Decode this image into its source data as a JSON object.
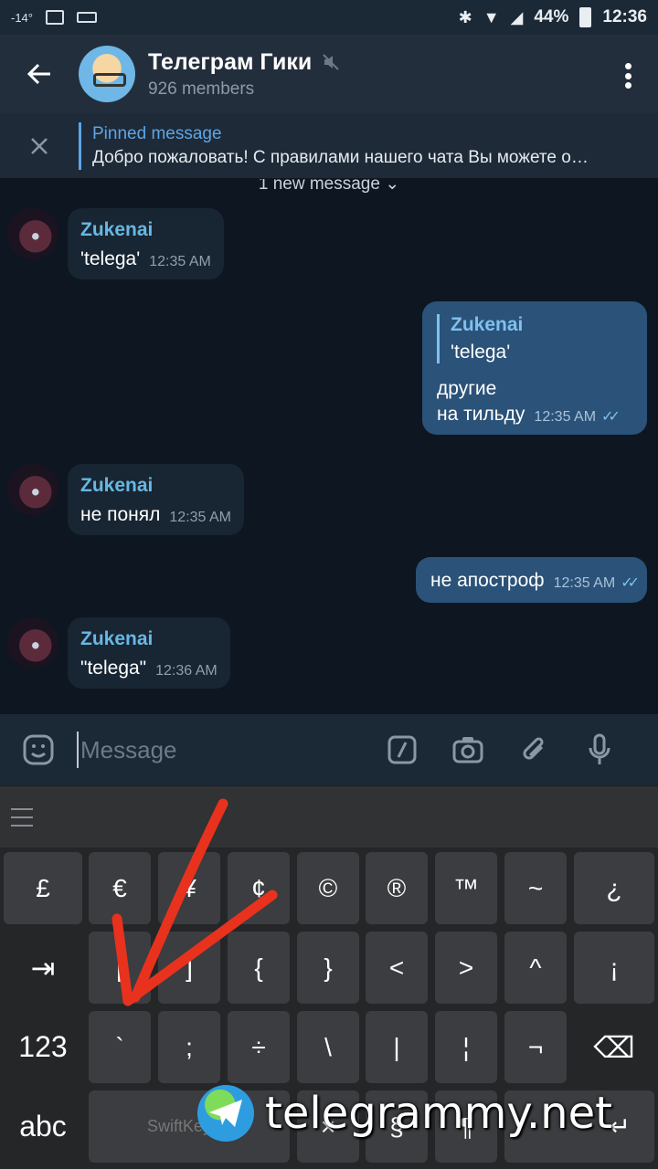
{
  "status_bar": {
    "temperature": "-14°",
    "battery": "44%",
    "time": "12:36"
  },
  "header": {
    "title": "Телеграм Гики",
    "subtitle": "926 members",
    "back_icon": "arrow-left-icon",
    "mute_icon": "muted-icon"
  },
  "pinned": {
    "title": "Pinned message",
    "text": "Добро пожаловать! С правилами нашего чата Вы можете о…"
  },
  "chat": {
    "new_messages_label": "1 new message",
    "messages": [
      {
        "sender": "Zukenai",
        "text": "'telega'",
        "time": "12:35 AM"
      },
      {
        "reply_sender": "Zukenai",
        "reply_text": "'telega'",
        "text_line1": "другие",
        "text_line2": "на тильду",
        "time": "12:35 AM"
      },
      {
        "sender": "Zukenai",
        "text": "не понял",
        "time": "12:35 AM"
      },
      {
        "text": "не апостроф",
        "time": "12:35 AM"
      },
      {
        "sender": "Zukenai",
        "text": "\"telega\"",
        "time": "12:36 AM"
      }
    ]
  },
  "input": {
    "placeholder": "Message"
  },
  "keyboard": {
    "row1": [
      "£",
      "€",
      "¥",
      "¢",
      "©",
      "®",
      "™",
      "~",
      "¿"
    ],
    "row2": [
      "⇥",
      "[",
      "]",
      "{",
      "}",
      "<",
      ">",
      "^",
      "¡"
    ],
    "row3": [
      "123",
      "`",
      ";",
      "÷",
      "\\",
      "|",
      "¦",
      "¬",
      "⌫"
    ],
    "row4": [
      "abc",
      "SwiftKey",
      "×",
      "§",
      "¶",
      "↵"
    ]
  },
  "watermark": {
    "text": "telegrammy.net"
  },
  "colors": {
    "header_bg": "#232e3c",
    "chat_bg": "#0e1621",
    "incoming_bubble": "#182533",
    "outgoing_bubble": "#2b5278",
    "accent": "#5ea5e6",
    "annotation_arrow": "#e8321e"
  }
}
